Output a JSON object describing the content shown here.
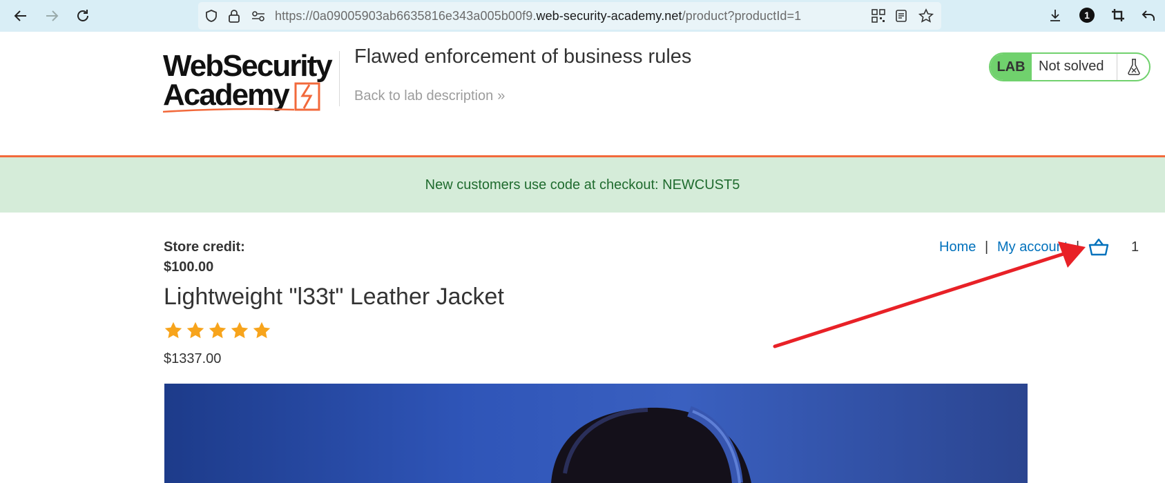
{
  "browser": {
    "url_prefix": "https://0a09005903ab6635816e343a005b00f9.",
    "url_host": "web-security-academy.net",
    "url_path": "/product?productId=1",
    "profile_badge": "1"
  },
  "header": {
    "logo_line1": "WebSecurity",
    "logo_line2": "Academy",
    "lab_title": "Flawed enforcement of business rules",
    "back_link": "Back to lab description",
    "lab_badge": "LAB",
    "lab_status": "Not solved"
  },
  "notice": {
    "text": "New customers use code at checkout: NEWCUST5"
  },
  "account": {
    "credit_label": "Store credit:",
    "credit_value": "$100.00"
  },
  "nav": {
    "home": "Home",
    "separator": "|",
    "my_account": "My account",
    "cart_count": "1"
  },
  "product": {
    "title": "Lightweight \"l33t\" Leather Jacket",
    "rating": 5,
    "price": "$1337.00"
  },
  "colors": {
    "accent_orange": "#f2693b",
    "link_blue": "#0071bc",
    "lab_green": "#70d16d",
    "notice_bg": "#d5ecd9",
    "star": "#f7a41c",
    "annotation_arrow": "#e82127"
  }
}
